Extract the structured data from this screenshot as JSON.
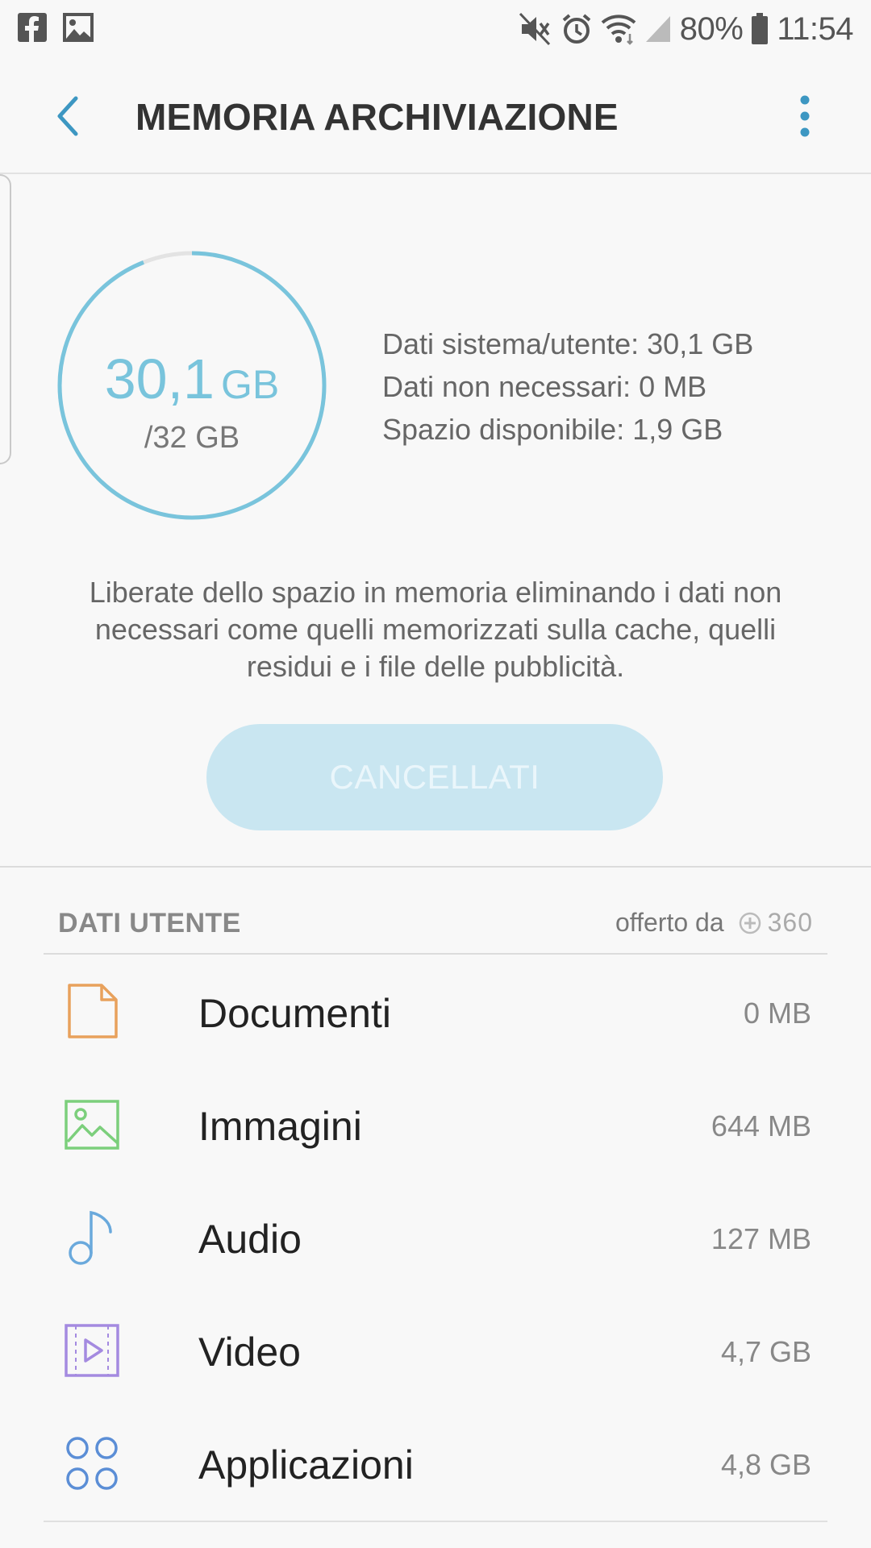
{
  "status_bar": {
    "battery": "80%",
    "time": "11:54"
  },
  "app_bar": {
    "title": "MEMORIA ARCHIVIAZIONE"
  },
  "storage": {
    "used_value": "30,1",
    "used_unit": "GB",
    "total": "/32 GB",
    "used_fraction": 0.94,
    "details": [
      "Dati sistema/utente: 30,1 GB",
      "Dati non necessari: 0 MB",
      "Spazio disponibile: 1,9 GB"
    ],
    "ring_color": "#79c4dc"
  },
  "hint": "Liberate dello spazio in memoria eliminando i dati non necessari come quelli memorizzati sulla cache, quelli residui e i file delle pubblicità.",
  "clean_button": {
    "label": "CANCELLATI"
  },
  "user_data": {
    "header": "DATI UTENTE",
    "offered_by": "offerto da",
    "brand": "360",
    "items": [
      {
        "label": "Documenti",
        "size": "0 MB",
        "icon": "document-icon",
        "color": "#e8a15c"
      },
      {
        "label": "Immagini",
        "size": "644 MB",
        "icon": "image-icon",
        "color": "#7ccf7c"
      },
      {
        "label": "Audio",
        "size": "127 MB",
        "icon": "music-note-icon",
        "color": "#6aa9dc"
      },
      {
        "label": "Video",
        "size": "4,7 GB",
        "icon": "video-icon",
        "color": "#a48ae0"
      },
      {
        "label": "Applicazioni",
        "size": "4,8 GB",
        "icon": "apps-icon",
        "color": "#5b8ed6"
      }
    ]
  }
}
